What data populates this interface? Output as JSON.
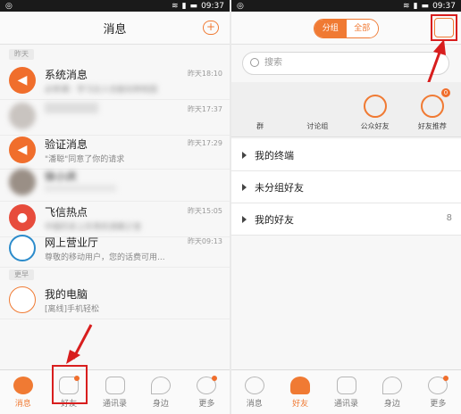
{
  "left": {
    "status": {
      "time": "09:37"
    },
    "header": {
      "title": "消息",
      "add_icon": "plus-chat-icon"
    },
    "tags": [
      "昨天",
      "更早"
    ],
    "messages": [
      {
        "name": "系统消息",
        "preview": "必修课：学习达人也能玩转校园",
        "time": "昨天18:10",
        "avatar": "speaker-icon"
      },
      {
        "name": "",
        "preview": "",
        "time": "昨天17:37",
        "avatar": "blurred"
      },
      {
        "name": "验证消息",
        "preview": "\"潘聪\"同意了你的请求",
        "time": "昨天17:29",
        "avatar": "speaker-icon"
      },
      {
        "name": "徐小庆",
        "preview": "",
        "time": "",
        "avatar": "blurred"
      },
      {
        "name": "飞信热点",
        "preview": "中国历史上珍贵的清朝之宝",
        "time": "昨天15:05",
        "avatar": "pin-icon"
      },
      {
        "name": "网上营业厅",
        "preview": "尊敬的移动用户，您的话费可用...",
        "time": "昨天09:13",
        "avatar": "china-mobile-logo"
      },
      {
        "name": "我的电脑",
        "preview": "[离线]手机轻松",
        "time": "",
        "avatar": "monitor-icon"
      }
    ],
    "tabs": [
      {
        "label": "消息",
        "icon": "message-icon"
      },
      {
        "label": "好友",
        "icon": "person-icon"
      },
      {
        "label": "通讯录",
        "icon": "phone-book-icon"
      },
      {
        "label": "身边",
        "icon": "location-pin-icon"
      },
      {
        "label": "更多",
        "icon": "more-dots-icon"
      }
    ]
  },
  "right": {
    "status": {
      "time": "09:37"
    },
    "segment": {
      "left": "分组",
      "right": "全部"
    },
    "search": {
      "placeholder": "搜索"
    },
    "quick": [
      {
        "label": "群",
        "icon": "group-icon"
      },
      {
        "label": "讨论组",
        "icon": "discussion-icon"
      },
      {
        "label": "公众好友",
        "icon": "star-icon"
      },
      {
        "label": "好友推荐",
        "icon": "recommend-icon",
        "badge": "0"
      }
    ],
    "groups": [
      {
        "name": "我的终端",
        "count": ""
      },
      {
        "name": "未分组好友",
        "count": ""
      },
      {
        "name": "我的好友",
        "count": "8"
      }
    ],
    "tabs": [
      {
        "label": "消息",
        "icon": "message-icon"
      },
      {
        "label": "好友",
        "icon": "person-icon"
      },
      {
        "label": "通讯录",
        "icon": "phone-book-icon"
      },
      {
        "label": "身边",
        "icon": "location-pin-icon"
      },
      {
        "label": "更多",
        "icon": "more-dots-icon"
      }
    ]
  },
  "colors": {
    "accent": "#f07a33",
    "annotation": "#d81e1e"
  }
}
